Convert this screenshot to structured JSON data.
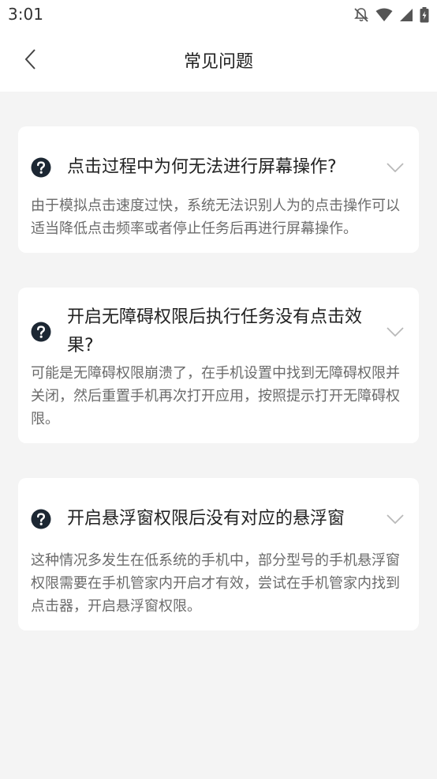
{
  "status_bar": {
    "time": "3:01",
    "icons": [
      "bell-off-icon",
      "wifi-icon",
      "signal-icon",
      "battery-charging-icon"
    ]
  },
  "header": {
    "back_icon": "chevron-left-icon",
    "title": "常见问题"
  },
  "faq": [
    {
      "question": "点击过程中为何无法进行屏幕操作?",
      "answer": "由于模拟点击速度过快，系统无法识别人为的点击操作可以适当降低点击频率或者停止任务后再进行屏幕操作。"
    },
    {
      "question": "开启无障碍权限后执行任务没有点击效果?",
      "answer": "可能是无障碍权限崩溃了，在手机设置中找到无障碍权限并关闭，然后重置手机再次打开应用，按照提示打开无障碍权限。"
    },
    {
      "question": "开启悬浮窗权限后没有对应的悬浮窗",
      "answer": "这种情况多发生在低系统的手机中，部分型号的手机悬浮窗权限需要在手机管家内开启才有效，尝试在手机管家内找到点击器，开启悬浮窗权限。"
    }
  ],
  "colors": {
    "background": "#f4f4f4",
    "card": "#ffffff",
    "question_icon": "#1c2733",
    "answer_text": "#6b6b6b"
  }
}
